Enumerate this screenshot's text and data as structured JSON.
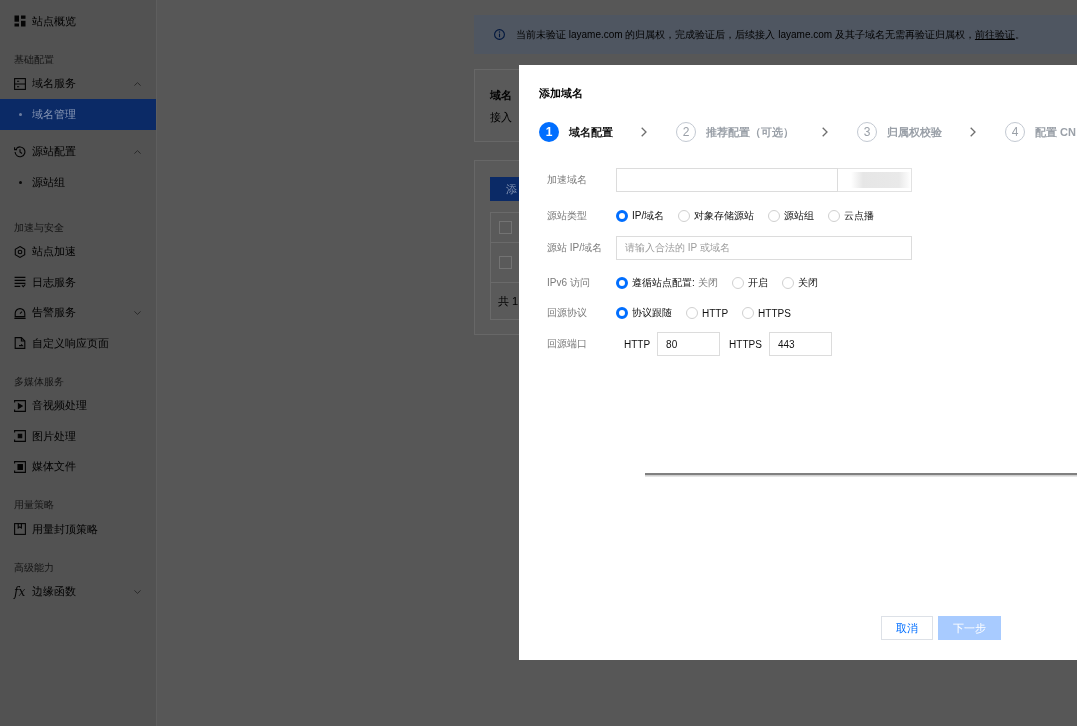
{
  "sidebar": {
    "sections": [
      {
        "items": [
          {
            "label": "站点概览",
            "kind": "link",
            "selected": false
          }
        ]
      },
      {
        "title": "基础配置",
        "items": [
          {
            "label": "域名服务",
            "kind": "submenu",
            "expanded": true,
            "selected": false,
            "children": [
              {
                "label": "域名管理",
                "selected": true
              }
            ]
          },
          {
            "label": "源站配置",
            "kind": "submenu",
            "expanded": true,
            "selected": false,
            "children": [
              {
                "label": "源站组",
                "selected": false
              }
            ]
          }
        ]
      },
      {
        "title": "加速与安全",
        "items": [
          {
            "label": "站点加速",
            "kind": "link",
            "selected": false
          },
          {
            "label": "日志服务",
            "kind": "link",
            "selected": false
          },
          {
            "label": "告警服务",
            "kind": "submenu",
            "expanded": false,
            "selected": false
          },
          {
            "label": "自定义响应页面",
            "kind": "link",
            "selected": false
          }
        ]
      },
      {
        "title": "多媒体服务",
        "items": [
          {
            "label": "音视频处理",
            "kind": "link",
            "selected": false
          },
          {
            "label": "图片处理",
            "kind": "link",
            "selected": false
          },
          {
            "label": "媒体文件",
            "kind": "link",
            "selected": false
          }
        ]
      },
      {
        "title": "用量策略",
        "items": [
          {
            "label": "用量封顶策略",
            "kind": "link",
            "selected": false
          }
        ]
      },
      {
        "title": "高级能力",
        "items": [
          {
            "label": "边缘函数",
            "kind": "submenu",
            "expanded": false,
            "selected": false,
            "icon_text": "fx"
          }
        ]
      }
    ]
  },
  "notice": {
    "text": "当前未验证 layame.com 的归属权，完成验证后，后续接入 layame.com 及其子域名无需再验证归属权，",
    "link": "前往验证",
    "suffix": "。"
  },
  "domain_card": {
    "title": "域名",
    "description": "接入"
  },
  "list_card": {
    "button": "添",
    "table": {
      "header_checked": false,
      "rows": [
        {
          "checked": false
        }
      ],
      "footer": "共 1"
    }
  },
  "dialog": {
    "title": "添加域名",
    "steps": [
      {
        "number": "1",
        "label": "域名配置",
        "active": true
      },
      {
        "number": "2",
        "label": "推荐配置（可选）",
        "active": false
      },
      {
        "number": "3",
        "label": "归属权校验",
        "active": false
      },
      {
        "number": "4",
        "label": "配置 CN",
        "active": false
      }
    ],
    "form": [
      {
        "kind": "input",
        "label": "加速域名",
        "addon": true
      },
      {
        "kind": "radio",
        "label": "源站类型",
        "options": [
          {
            "label": "IP/域名",
            "selected": true
          },
          {
            "label": "对象存储源站",
            "selected": false
          },
          {
            "label": "源站组",
            "selected": false
          },
          {
            "label": "云点播",
            "selected": false
          }
        ]
      },
      {
        "kind": "input",
        "label": "源站 IP/域名",
        "placeholder": "请输入合法的 IP 或域名"
      },
      {
        "kind": "radio",
        "label": "IPv6 访问",
        "options": [
          {
            "label": "遵循站点配置:",
            "note": "关闭",
            "selected": true
          },
          {
            "label": "开启",
            "selected": false
          },
          {
            "label": "关闭",
            "selected": false
          }
        ]
      },
      {
        "kind": "radio",
        "label": "回源协议",
        "options": [
          {
            "label": "协议跟随",
            "selected": true
          },
          {
            "label": "HTTP",
            "selected": false
          },
          {
            "label": "HTTPS",
            "selected": false
          }
        ]
      },
      {
        "kind": "ports",
        "label": "回源端口",
        "ports": [
          {
            "label": "HTTP",
            "value": "80"
          },
          {
            "label": "HTTPS",
            "value": "443"
          }
        ]
      }
    ],
    "buttons": [
      {
        "label": "取消",
        "kind": "secondary",
        "disabled": false
      },
      {
        "label": "下一步",
        "kind": "primary",
        "disabled": true
      }
    ]
  }
}
